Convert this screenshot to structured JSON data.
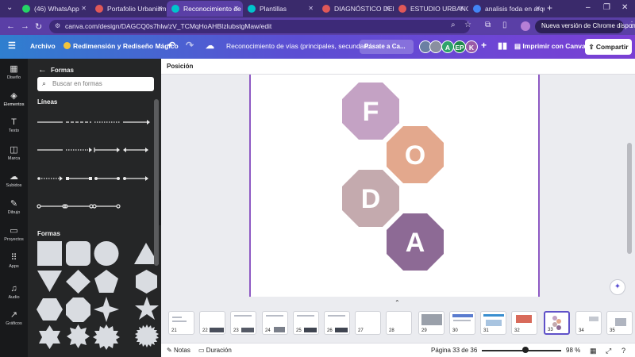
{
  "browser": {
    "tabs": [
      {
        "label": "(46) WhatsApp",
        "favicon_color": "#25d366",
        "active": false
      },
      {
        "label": "Portafolio Urbanismo",
        "favicon_color": "#e05858",
        "active": false
      },
      {
        "label": "Reconocimiento de v",
        "favicon_color": "#00c4cc",
        "active": true
      },
      {
        "label": "Plantillas",
        "favicon_color": "#00c4cc",
        "active": false
      },
      {
        "label": "DIAGNÓSTICO DEL",
        "favicon_color": "#e05858",
        "active": false
      },
      {
        "label": "ESTUDIO URBANO",
        "favicon_color": "#e05858",
        "active": false
      },
      {
        "label": "analisis foda en arqu",
        "favicon_color": "#4285f4",
        "active": false
      }
    ],
    "new_tab": "+",
    "url": "canva.com/design/DAGCQ0s7hlw/zV_TCMqHoAHBIzlubstgMaw/edit",
    "update_label": "Nueva versión de Chrome disponible",
    "window_controls": [
      "–",
      "❐",
      "✕"
    ]
  },
  "canva_bar": {
    "menu_label": "☰",
    "file_label": "Archivo",
    "magic_label": "Redimensión y Rediseño Mágico",
    "undo": "↶",
    "redo": "↷",
    "cloud": "☁",
    "doc_title": "Reconocimiento de vías (principales, secundari...",
    "pro_label": "Pásate a Ca...",
    "avatars": [
      {
        "label": "A",
        "color": "#2ea36b"
      },
      {
        "label": "EP",
        "color": "#1f8a4c"
      },
      {
        "label": "K",
        "color": "#9a5aa8"
      }
    ],
    "add_collaborator": "+",
    "print_label": "Imprimir con Canva",
    "share_label": "Compartir"
  },
  "rail": [
    {
      "label": "Diseño",
      "icon": "▦"
    },
    {
      "label": "Elementos",
      "icon": "◈"
    },
    {
      "label": "Texto",
      "icon": "T"
    },
    {
      "label": "Marca",
      "icon": "◫"
    },
    {
      "label": "Subidos",
      "icon": "☁"
    },
    {
      "label": "Dibujo",
      "icon": "✎"
    },
    {
      "label": "Proyectos",
      "icon": "▭"
    },
    {
      "label": "Apps",
      "icon": "⠿"
    },
    {
      "label": "Audio",
      "icon": "♫"
    },
    {
      "label": "Gráficos",
      "icon": "↗"
    }
  ],
  "panel": {
    "back": "←",
    "title": "Formas",
    "search_placeholder": "Buscar en formas",
    "lines_title": "Líneas",
    "shapes_title": "Formas"
  },
  "workspace": {
    "position_label": "Posición",
    "letters": [
      {
        "char": "F",
        "color": "#c4a2c4"
      },
      {
        "char": "O",
        "color": "#e3a88d"
      },
      {
        "char": "D",
        "color": "#c4aaae"
      },
      {
        "char": "A",
        "color": "#8d6a95"
      }
    ]
  },
  "filmstrip": {
    "pages": [
      "21",
      "22",
      "23",
      "24",
      "25",
      "26",
      "27",
      "28",
      "29",
      "30",
      "31",
      "32",
      "33",
      "34",
      "35"
    ],
    "current": "33"
  },
  "status": {
    "notes": "Notas",
    "duration": "Duración",
    "page_info": "Página 33 de 36",
    "zoom": "98 %",
    "zoom_level": 0.55
  }
}
